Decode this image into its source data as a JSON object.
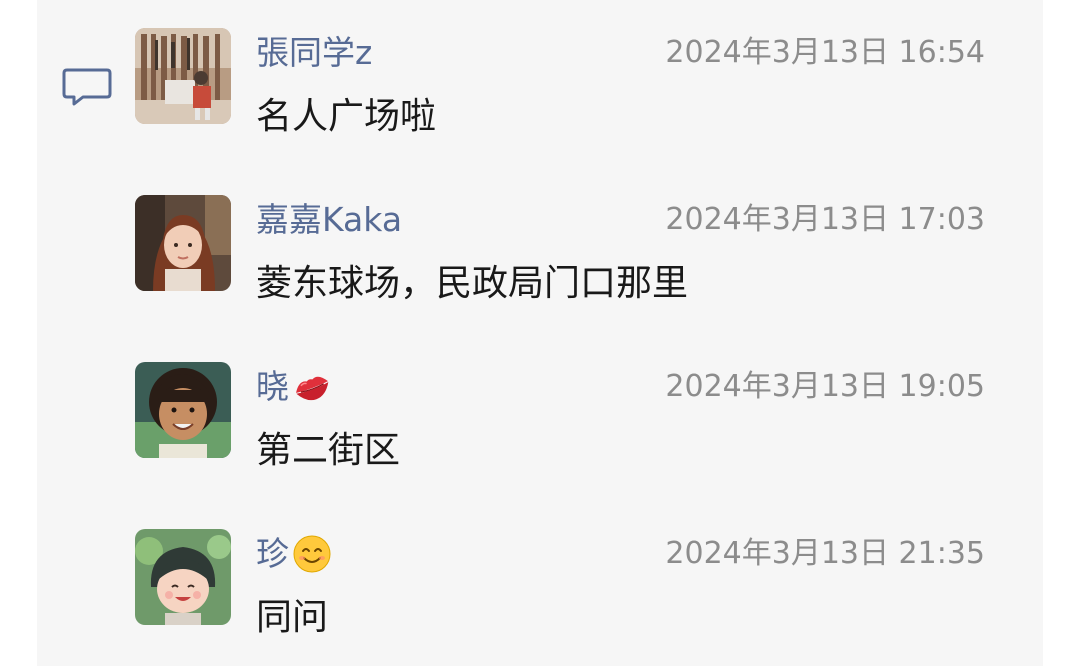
{
  "comments": [
    {
      "name": "張同学z",
      "time": "2024年3月13日 16:54",
      "text": "名人广场啦"
    },
    {
      "name": "嘉嘉Kaka",
      "time": "2024年3月13日 17:03",
      "text": "菱东球场，民政局门口那里"
    },
    {
      "name": "晓",
      "name_emoji": "lips-emoji",
      "time": "2024年3月13日 19:05",
      "text": "第二街区"
    },
    {
      "name": "珍",
      "name_emoji": "smiling-face-emoji",
      "time": "2024年3月13日 21:35",
      "text": "同问"
    }
  ],
  "colors": {
    "name": "#576b95",
    "time": "#8c8c8c",
    "text": "#191919",
    "panel_background": "#f6f6f6"
  },
  "icons": {
    "section_icon": "comment-icon"
  }
}
